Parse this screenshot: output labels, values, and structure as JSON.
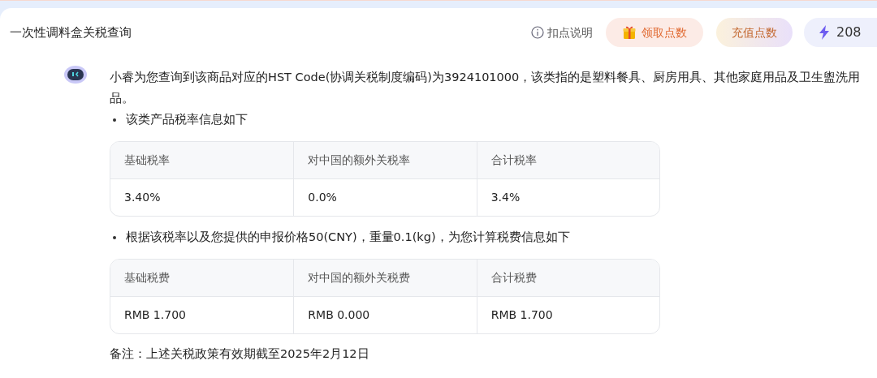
{
  "header": {
    "title": "一次性调料盒关税查询",
    "help_link": "扣点说明",
    "claim_button": "领取点数",
    "recharge_button": "充值点数",
    "points": "208"
  },
  "message": {
    "intro": "小睿为您查询到该商品对应的HST Code(协调关税制度编码)为3924101000，该类指的是塑料餐具、厨房用具、其他家庭用品及卫生盥洗用品。",
    "sections": [
      {
        "bullet": "该类产品税率信息如下",
        "table": {
          "columns": [
            "基础税率",
            "对中国的额外关税率",
            "合计税率"
          ],
          "rows": [
            [
              "3.40%",
              "0.0%",
              "3.4%"
            ]
          ]
        }
      },
      {
        "bullet": "根据该税率以及您提供的申报价格50(CNY)，重量0.1(kg)，为您计算税费信息如下",
        "table": {
          "columns": [
            "基础税费",
            "对中国的额外关税费",
            "合计税费"
          ],
          "rows": [
            [
              "RMB 1.700",
              "RMB 0.000",
              "RMB 1.700"
            ]
          ]
        }
      }
    ],
    "note": "备注：上述关税政策有效期截至2025年2月12日"
  }
}
